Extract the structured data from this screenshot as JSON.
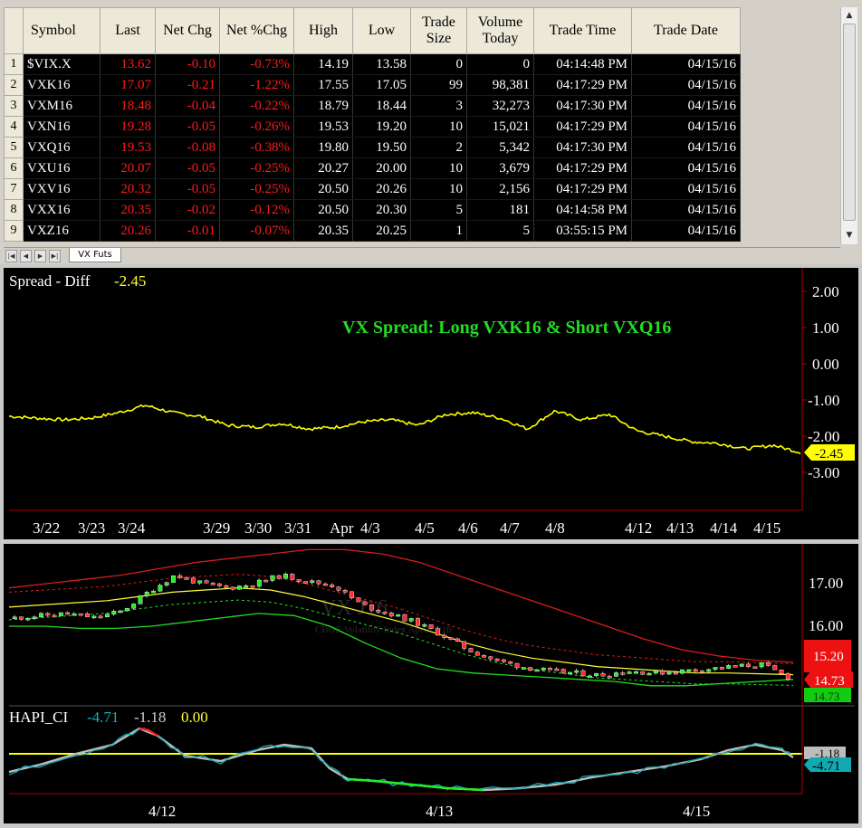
{
  "quote_table": {
    "columns": [
      "Symbol",
      "Last",
      "Net Chg",
      "Net %Chg",
      "High",
      "Low",
      "Trade Size",
      "Volume Today",
      "Trade Time",
      "Trade Date"
    ],
    "rows": [
      {
        "n": "1",
        "symbol": "$VIX.X",
        "last": "13.62",
        "net_chg": "-0.10",
        "net_pct": "-0.73%",
        "high": "14.19",
        "low": "13.58",
        "size": "0",
        "volume": "0",
        "time": "04:14:48 PM",
        "date": "04/15/16"
      },
      {
        "n": "2",
        "symbol": "VXK16",
        "last": "17.07",
        "net_chg": "-0.21",
        "net_pct": "-1.22%",
        "high": "17.55",
        "low": "17.05",
        "size": "99",
        "volume": "98,381",
        "time": "04:17:29 PM",
        "date": "04/15/16"
      },
      {
        "n": "3",
        "symbol": "VXM16",
        "last": "18.48",
        "net_chg": "-0.04",
        "net_pct": "-0.22%",
        "high": "18.79",
        "low": "18.44",
        "size": "3",
        "volume": "32,273",
        "time": "04:17:30 PM",
        "date": "04/15/16"
      },
      {
        "n": "4",
        "symbol": "VXN16",
        "last": "19.28",
        "net_chg": "-0.05",
        "net_pct": "-0.26%",
        "high": "19.53",
        "low": "19.20",
        "size": "10",
        "volume": "15,021",
        "time": "04:17:29 PM",
        "date": "04/15/16"
      },
      {
        "n": "5",
        "symbol": "VXQ16",
        "last": "19.53",
        "net_chg": "-0.08",
        "net_pct": "-0.38%",
        "high": "19.80",
        "low": "19.50",
        "size": "2",
        "volume": "5,342",
        "time": "04:17:30 PM",
        "date": "04/15/16"
      },
      {
        "n": "6",
        "symbol": "VXU16",
        "last": "20.07",
        "net_chg": "-0.05",
        "net_pct": "-0.25%",
        "high": "20.27",
        "low": "20.00",
        "size": "10",
        "volume": "3,679",
        "time": "04:17:29 PM",
        "date": "04/15/16"
      },
      {
        "n": "7",
        "symbol": "VXV16",
        "last": "20.32",
        "net_chg": "-0.05",
        "net_pct": "-0.25%",
        "high": "20.50",
        "low": "20.26",
        "size": "10",
        "volume": "2,156",
        "time": "04:17:29 PM",
        "date": "04/15/16"
      },
      {
        "n": "8",
        "symbol": "VXX16",
        "last": "20.35",
        "net_chg": "-0.02",
        "net_pct": "-0.12%",
        "high": "20.50",
        "low": "20.30",
        "size": "5",
        "volume": "181",
        "time": "04:14:58 PM",
        "date": "04/15/16"
      },
      {
        "n": "9",
        "symbol": "VXZ16",
        "last": "20.26",
        "net_chg": "-0.01",
        "net_pct": "-0.07%",
        "high": "20.35",
        "low": "20.25",
        "size": "1",
        "volume": "5",
        "time": "03:55:15 PM",
        "date": "04/15/16"
      }
    ],
    "sheet_tab": "VX Futs"
  },
  "spread_chart": {
    "label": "Spread - Diff",
    "value": "-2.45",
    "annotation": "VX Spread: Long VXK16 & Short VXQ16",
    "y_ticks": [
      "2.00",
      "1.00",
      "0.00",
      "-1.00",
      "-2.00",
      "-3.00"
    ],
    "x_labels": [
      "3/22",
      "3/23",
      "3/24",
      "3/29",
      "3/30",
      "3/31",
      "Apr",
      "4/3",
      "4/5",
      "4/6",
      "4/7",
      "4/8",
      "4/12",
      "4/13",
      "4/14",
      "4/15"
    ],
    "last_badge": "-2.45"
  },
  "price_chart": {
    "watermark_title": "VX J16",
    "watermark_sub": "CBOE Volatility Index April 2016",
    "y_ticks": [
      "17.00",
      "16.00"
    ],
    "badges": {
      "upper": "15.20",
      "mid": "14.73",
      "lower": "14.73"
    }
  },
  "indicator": {
    "label": "HAPI_CI",
    "v1": "-4.71",
    "v2": "-1.18",
    "v3": "0.00",
    "badges": {
      "gray": "-1.18",
      "teal": "-4.71"
    },
    "x_labels": [
      "4/12",
      "4/13",
      "4/15"
    ]
  },
  "chart_data": [
    {
      "type": "line",
      "title": "VX Spread: Long VXK16 & Short VXQ16",
      "series": [
        {
          "name": "Spread - Diff",
          "values": [
            -1.45,
            -1.5,
            -1.55,
            -1.5,
            -1.35,
            -1.15,
            -1.35,
            -1.45,
            -1.7,
            -1.75,
            -1.65,
            -1.8,
            -1.75,
            -1.6,
            -1.55,
            -1.7,
            -1.4,
            -1.35,
            -1.5,
            -1.8,
            -1.3,
            -1.55,
            -1.4,
            -1.85,
            -2.0,
            -2.15,
            -2.2,
            -2.35,
            -2.25,
            -2.45
          ]
        }
      ],
      "x": [
        "3/22",
        "3/23",
        "3/24",
        "3/29",
        "3/30",
        "3/31",
        "Apr",
        "4/3",
        "4/5",
        "4/6",
        "4/7",
        "4/8",
        "4/12",
        "4/13",
        "4/14",
        "4/15"
      ],
      "ylim": [
        -3.5,
        2.4
      ],
      "color": "#ffff00"
    },
    {
      "type": "line",
      "series": [
        {
          "name": "price",
          "values": [
            16.2,
            16.25,
            16.3,
            16.2,
            16.35,
            16.8,
            17.2,
            17.0,
            16.9,
            17.0,
            17.2,
            17.05,
            16.95,
            16.5,
            16.3,
            16.1,
            15.8,
            15.45,
            15.2,
            15.05,
            14.95,
            14.9,
            14.85,
            14.95,
            14.9,
            14.95,
            15.0,
            15.05,
            15.1,
            14.8
          ]
        },
        {
          "name": "yellow",
          "values": [
            16.45,
            16.5,
            16.55,
            16.6,
            16.7,
            16.8,
            16.85,
            16.9,
            16.85,
            16.7,
            16.5,
            16.3,
            16.1,
            15.85,
            15.6,
            15.4,
            15.25,
            15.15,
            15.05,
            15.0,
            14.95,
            14.9,
            14.9,
            14.88,
            14.86
          ]
        },
        {
          "name": "red",
          "values": [
            16.9,
            17.0,
            17.1,
            17.2,
            17.35,
            17.5,
            17.6,
            17.7,
            17.8,
            17.8,
            17.7,
            17.5,
            17.2,
            16.9,
            16.6,
            16.3,
            16.0,
            15.7,
            15.45,
            15.3,
            15.2,
            15.15
          ]
        },
        {
          "name": "green",
          "values": [
            16.0,
            16.0,
            15.95,
            15.95,
            16.0,
            16.1,
            16.2,
            16.3,
            16.25,
            16.0,
            15.6,
            15.25,
            15.0,
            14.9,
            14.85,
            14.8,
            14.75,
            14.7,
            14.6,
            14.6,
            14.65,
            14.7,
            14.75
          ]
        }
      ],
      "ylim": [
        14.2,
        17.7
      ]
    },
    {
      "type": "line",
      "series": [
        {
          "name": "HAPI_CI",
          "values": [
            -4.71
          ]
        },
        {
          "name": "signal",
          "values": [
            -1.18
          ]
        },
        {
          "name": "zero",
          "values": [
            0.0
          ]
        }
      ],
      "x": [
        "4/12",
        "4/13",
        "4/15"
      ]
    }
  ],
  "colors": {
    "positive": "#ffffff",
    "negative": "#ff1a1a",
    "spread": "#ffff00",
    "annotation": "#22dd22",
    "tick": "#ffffff"
  }
}
